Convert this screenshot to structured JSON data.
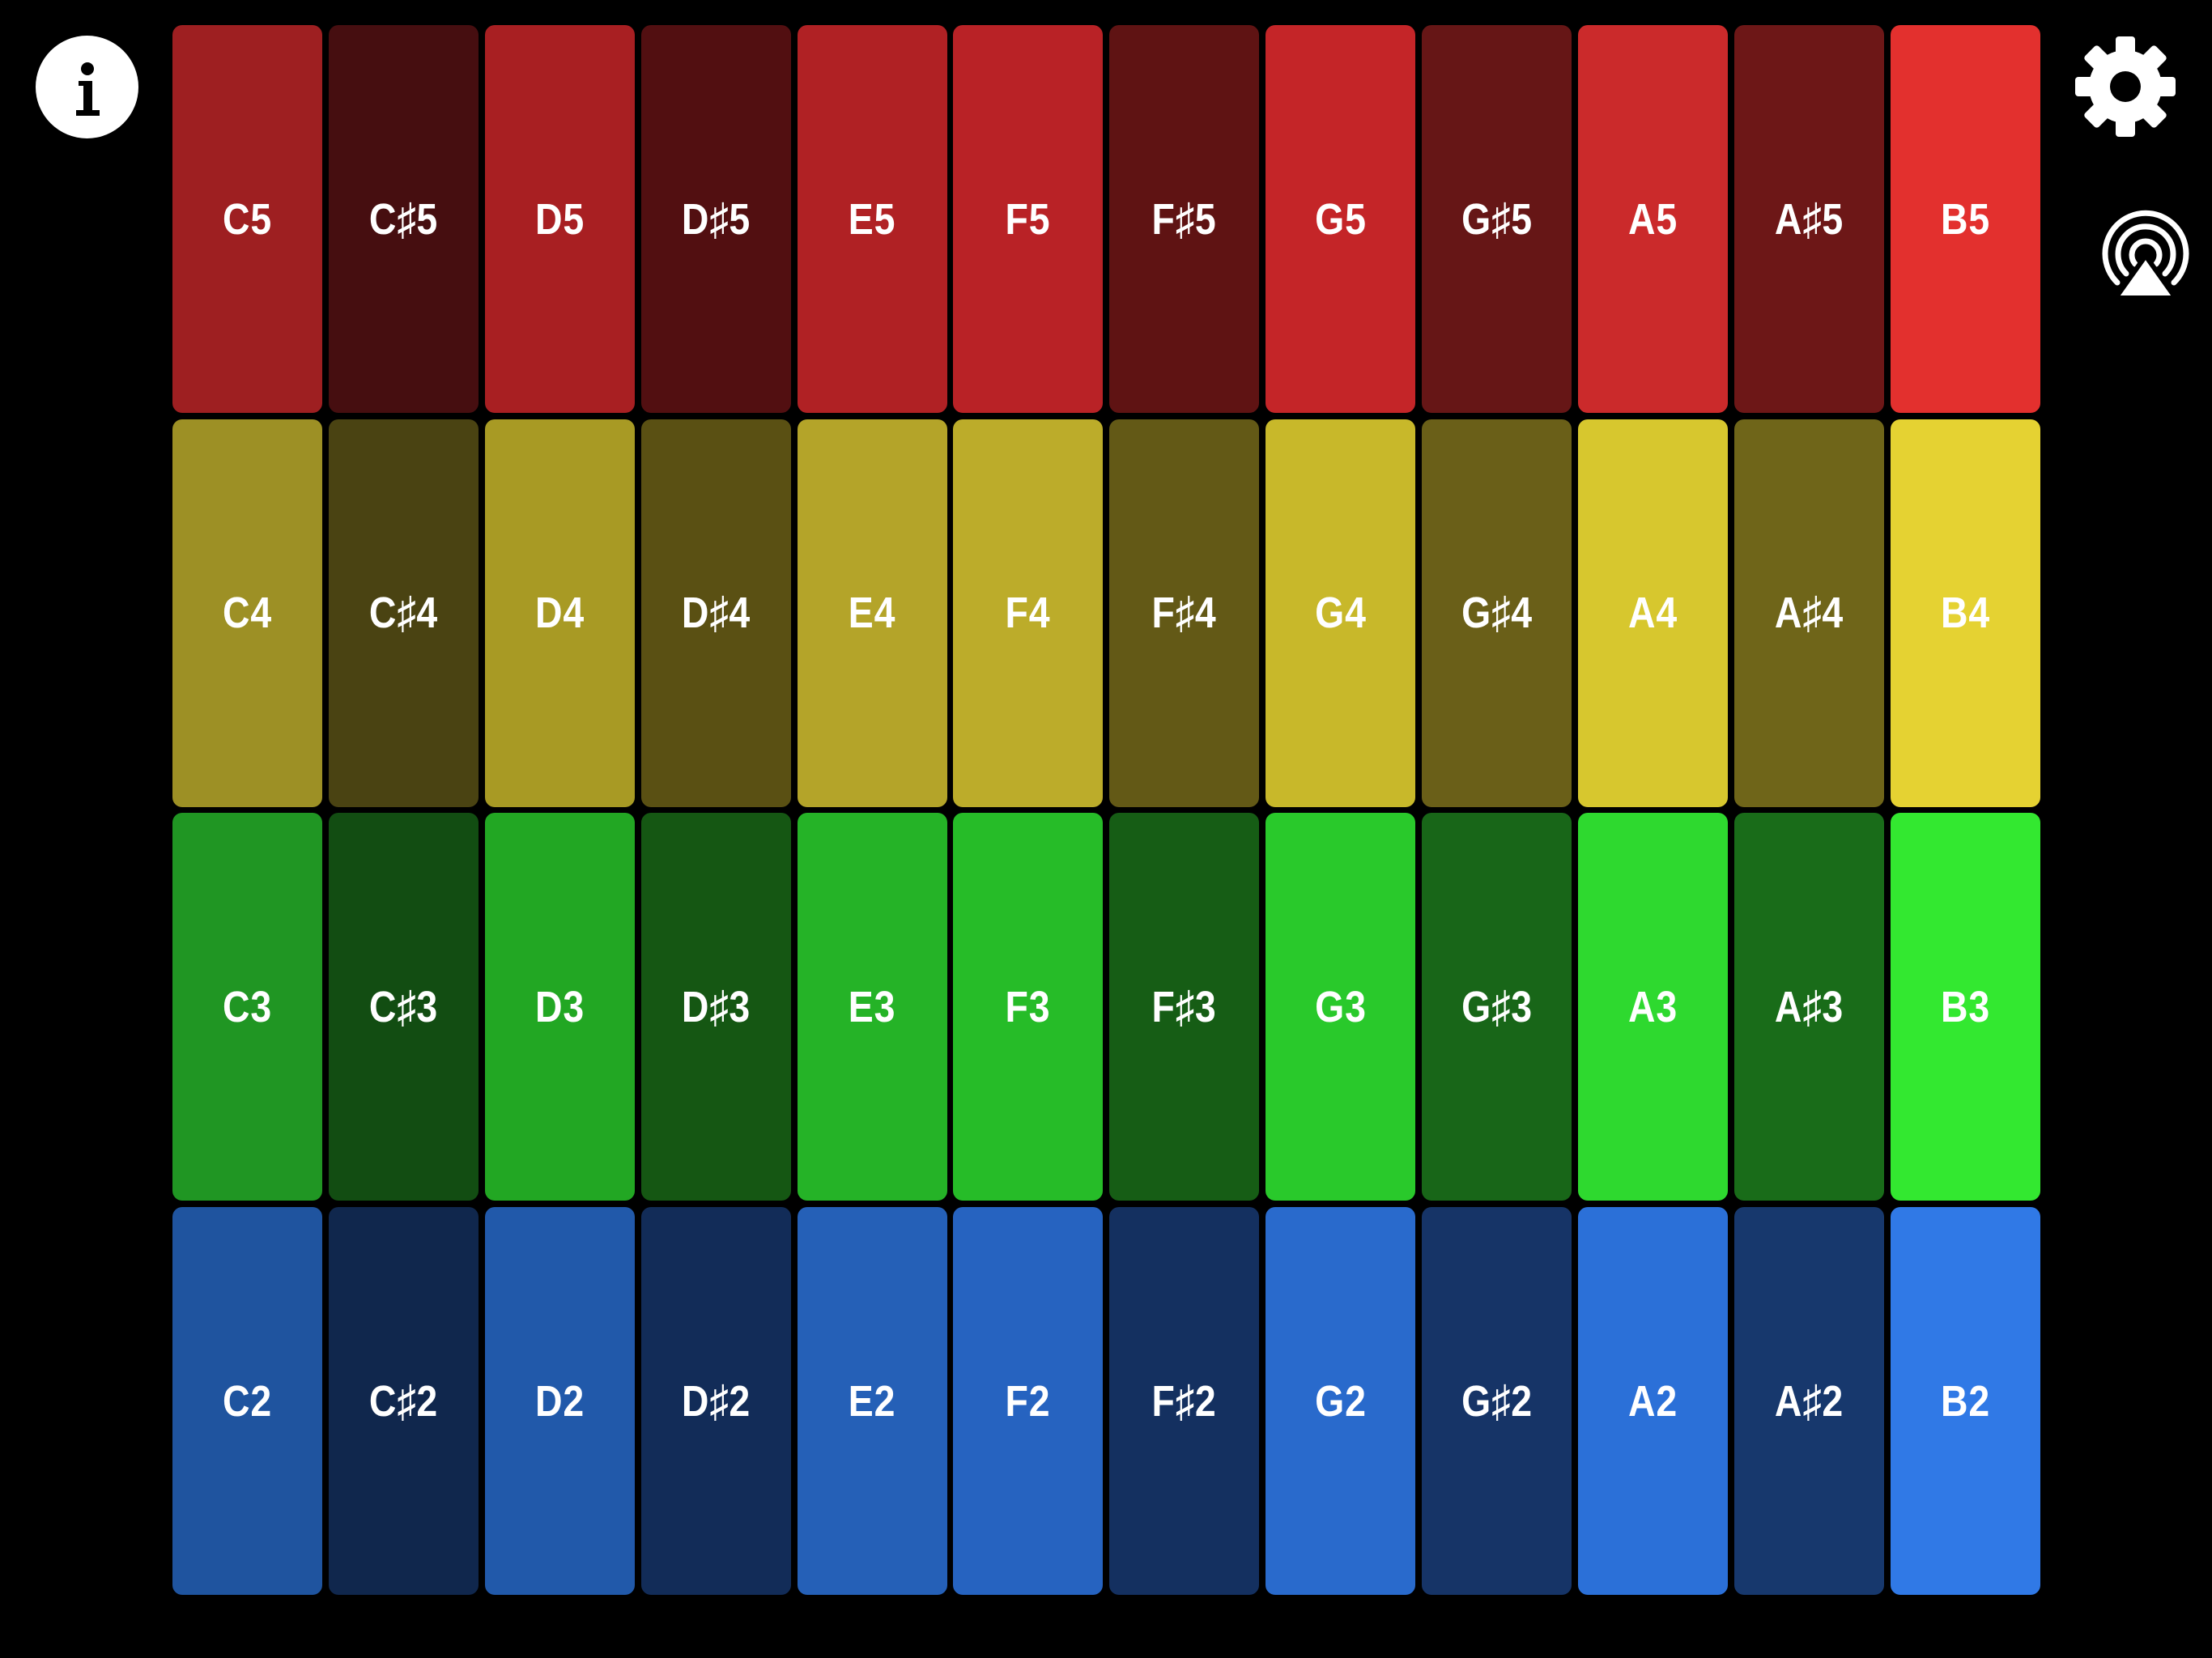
{
  "toolbar": {
    "info_icon": "info-icon",
    "settings_icon": "gear-icon",
    "airplay_icon": "airplay-icon"
  },
  "pad_rows": [
    {
      "octave": "5",
      "colors": {
        "natural": [
          "#9e1f21",
          "#a81f22",
          "#b02124",
          "#b92226",
          "#c42528",
          "#cb2a2b",
          "#e3302e"
        ],
        "sharp": [
          "#460e10",
          "#520f11",
          "#5f1313",
          "#661616",
          "#6d1717"
        ]
      },
      "pads": [
        {
          "label": "C5",
          "color": "#9e1f21"
        },
        {
          "label": "C♯5",
          "color": "#460e10"
        },
        {
          "label": "D5",
          "color": "#a81f22"
        },
        {
          "label": "D♯5",
          "color": "#520f11"
        },
        {
          "label": "E5",
          "color": "#b02124"
        },
        {
          "label": "F5",
          "color": "#b92226"
        },
        {
          "label": "F♯5",
          "color": "#5f1313"
        },
        {
          "label": "G5",
          "color": "#c42528"
        },
        {
          "label": "G♯5",
          "color": "#661616"
        },
        {
          "label": "A5",
          "color": "#cb2a2b"
        },
        {
          "label": "A♯5",
          "color": "#6d1717"
        },
        {
          "label": "B5",
          "color": "#e3302e"
        }
      ]
    },
    {
      "octave": "4",
      "pads": [
        {
          "label": "C4",
          "color": "#9d9025"
        },
        {
          "label": "C♯4",
          "color": "#4a4312"
        },
        {
          "label": "D4",
          "color": "#a89a24"
        },
        {
          "label": "D♯4",
          "color": "#5a5013"
        },
        {
          "label": "E4",
          "color": "#b4a429"
        },
        {
          "label": "F4",
          "color": "#bcac2a"
        },
        {
          "label": "F♯4",
          "color": "#635916"
        },
        {
          "label": "G4",
          "color": "#c8b82a"
        },
        {
          "label": "G♯4",
          "color": "#6a5f18"
        },
        {
          "label": "A4",
          "color": "#d7c72e"
        },
        {
          "label": "A♯4",
          "color": "#6f6519"
        },
        {
          "label": "B4",
          "color": "#e5d232"
        }
      ]
    },
    {
      "octave": "3",
      "pads": [
        {
          "label": "C3",
          "color": "#209623"
        },
        {
          "label": "C♯3",
          "color": "#124d12"
        },
        {
          "label": "D3",
          "color": "#22a723"
        },
        {
          "label": "D♯3",
          "color": "#155713"
        },
        {
          "label": "E3",
          "color": "#25b327"
        },
        {
          "label": "F3",
          "color": "#26bc28"
        },
        {
          "label": "F♯3",
          "color": "#165d15"
        },
        {
          "label": "G3",
          "color": "#29c92b"
        },
        {
          "label": "G♯3",
          "color": "#186618"
        },
        {
          "label": "A3",
          "color": "#2ed92f"
        },
        {
          "label": "A♯3",
          "color": "#196c19"
        },
        {
          "label": "B3",
          "color": "#33e830"
        }
      ]
    },
    {
      "octave": "2",
      "pads": [
        {
          "label": "C2",
          "color": "#1f549f"
        },
        {
          "label": "C♯2",
          "color": "#10274d"
        },
        {
          "label": "D2",
          "color": "#2159aa"
        },
        {
          "label": "D♯2",
          "color": "#122c58"
        },
        {
          "label": "E2",
          "color": "#2560b7"
        },
        {
          "label": "F2",
          "color": "#2663c0"
        },
        {
          "label": "F♯2",
          "color": "#143060"
        },
        {
          "label": "G2",
          "color": "#296acc"
        },
        {
          "label": "G♯2",
          "color": "#163467"
        },
        {
          "label": "A2",
          "color": "#2b70d8"
        },
        {
          "label": "A♯2",
          "color": "#17386d"
        },
        {
          "label": "B2",
          "color": "#3079e6"
        }
      ]
    }
  ]
}
